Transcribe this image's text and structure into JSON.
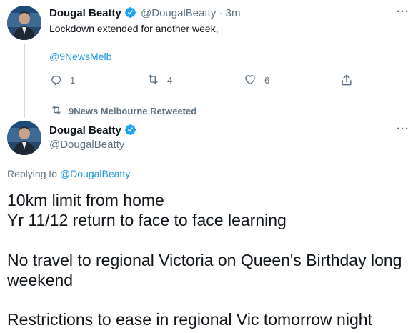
{
  "tweet1": {
    "display_name": "Dougal Beatty",
    "handle": "@DougalBeatty",
    "separator": "·",
    "time": "3m",
    "text": "Lockdown extended for another week,",
    "mention": "@9NewsMelb",
    "actions": {
      "reply_count": "1",
      "retweet_count": "4",
      "like_count": "6"
    }
  },
  "retweet_banner": {
    "label": "9News Melbourne Retweeted"
  },
  "tweet2": {
    "display_name": "Dougal Beatty",
    "handle": "@DougalBeatty",
    "replying_prefix": "Replying to",
    "replying_to": "@DougalBeatty",
    "lines": [
      "10km limit from home",
      "Yr 11/12 return to face to face learning",
      "No travel to regional Victoria on Queen's Birthday long",
      "weekend",
      "Restrictions to ease in regional Vic tomorrow night"
    ]
  },
  "colors": {
    "text": "#0f1419",
    "secondary": "#5b7083",
    "accent": "#1b95e0",
    "verified": "#1da1f2"
  },
  "icons": [
    "verified-badge-icon",
    "more-icon",
    "reply-icon",
    "retweet-icon",
    "like-icon",
    "share-icon"
  ]
}
